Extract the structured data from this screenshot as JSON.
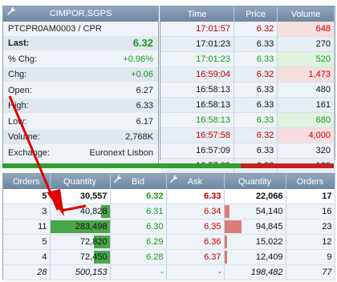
{
  "quote": {
    "title": "CIMPOR,SGPS",
    "symbol": "PTCPR0AM0003 / CPR",
    "rows": [
      {
        "label": "Last:",
        "value": "6.32",
        "style": "last"
      },
      {
        "label": "% Chg:",
        "value": "+0.96%",
        "style": "green"
      },
      {
        "label": "Chg:",
        "value": "+0.06",
        "style": "green"
      },
      {
        "label": "Open:",
        "value": "6.27"
      },
      {
        "label": "High:",
        "value": "6.33"
      },
      {
        "label": "Low:",
        "value": "6.17"
      },
      {
        "label": "Volume:",
        "value": "2,768K"
      },
      {
        "label": "Exchange:",
        "value": "Euronext Lisbon"
      }
    ]
  },
  "trades": {
    "headers": [
      "Time",
      "Price",
      "Volume"
    ],
    "rows": [
      {
        "time": "17:01:57",
        "price": "6.32",
        "volume": "648",
        "color": "red"
      },
      {
        "time": "17:01:23",
        "price": "6.33",
        "volume": "270",
        "color": "blk"
      },
      {
        "time": "17:01:23",
        "price": "6.33",
        "volume": "520",
        "color": "green"
      },
      {
        "time": "16:59:04",
        "price": "6.32",
        "volume": "1,473",
        "color": "red"
      },
      {
        "time": "16:58:13",
        "price": "6.33",
        "volume": "480",
        "color": "blk"
      },
      {
        "time": "16:58:13",
        "price": "6.33",
        "volume": "161",
        "color": "blk"
      },
      {
        "time": "16:58:13",
        "price": "6.33",
        "volume": "680",
        "color": "green"
      },
      {
        "time": "16:57:58",
        "price": "6.32",
        "volume": "4,000",
        "color": "red"
      },
      {
        "time": "16:57:09",
        "price": "6.33",
        "volume": "320",
        "color": "blk"
      },
      {
        "time": "16:57:09",
        "price": "6.33",
        "volume": "180",
        "color": "blk"
      }
    ]
  },
  "band": {
    "bid_share": 0.72
  },
  "book": {
    "headers": [
      "Orders",
      "Quantity",
      "Bid",
      "Ask",
      "Quantity",
      "Orders"
    ],
    "rows": [
      {
        "bid_orders": "5",
        "bid_qty": "30,557",
        "bid_fill": 0.0,
        "bid": "6.32",
        "ask": "6.33",
        "ask_qty": "22,066",
        "ask_fill": 0.0,
        "ask_orders": "17"
      },
      {
        "bid_orders": "3",
        "bid_qty": "40,828",
        "bid_fill": 0.14,
        "bid": "6.31",
        "ask": "6.34",
        "ask_qty": "54,140",
        "ask_fill": 0.09,
        "ask_orders": "16"
      },
      {
        "bid_orders": "11",
        "bid_qty": "283,498",
        "bid_fill": 1.0,
        "bid": "6.30",
        "ask": "6.35",
        "ask_qty": "94,845",
        "ask_fill": 0.28,
        "ask_orders": "23"
      },
      {
        "bid_orders": "5",
        "bid_qty": "72,820",
        "bid_fill": 0.26,
        "bid": "6.29",
        "ask": "6.36",
        "ask_qty": "15,022",
        "ask_fill": 0.05,
        "ask_orders": "12"
      },
      {
        "bid_orders": "4",
        "bid_qty": "72,450",
        "bid_fill": 0.26,
        "bid": "6.28",
        "ask": "6.37",
        "ask_qty": "12,409",
        "ask_fill": 0.04,
        "ask_orders": "9"
      },
      {
        "bid_orders": "28",
        "bid_qty": "500,153",
        "bid_fill": 0.0,
        "bid": "-",
        "ask": "-",
        "ask_qty": "198,482",
        "ask_fill": 0.0,
        "ask_orders": "77",
        "total": true
      }
    ]
  },
  "colors": {
    "bid": "#1a9a1a",
    "ask": "#c00000",
    "header": "#7d95ae",
    "arrow": "#e00000"
  }
}
